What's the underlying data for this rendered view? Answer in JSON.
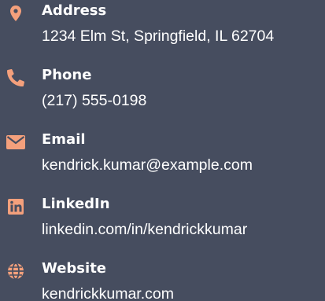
{
  "accent_color": "#f4a07c",
  "background_color": "#464d5f",
  "contacts": [
    {
      "icon": "map-pin-icon",
      "label": "Address",
      "value": "1234 Elm St, Springfield, IL 62704"
    },
    {
      "icon": "phone-icon",
      "label": "Phone",
      "value": "(217) 555-0198"
    },
    {
      "icon": "envelope-icon",
      "label": "Email",
      "value": "kendrick.kumar@example.com"
    },
    {
      "icon": "linkedin-icon",
      "label": "LinkedIn",
      "value": "linkedin.com/in/kendrickkumar"
    },
    {
      "icon": "globe-icon",
      "label": "Website",
      "value": "kendrickkumar.com"
    }
  ]
}
